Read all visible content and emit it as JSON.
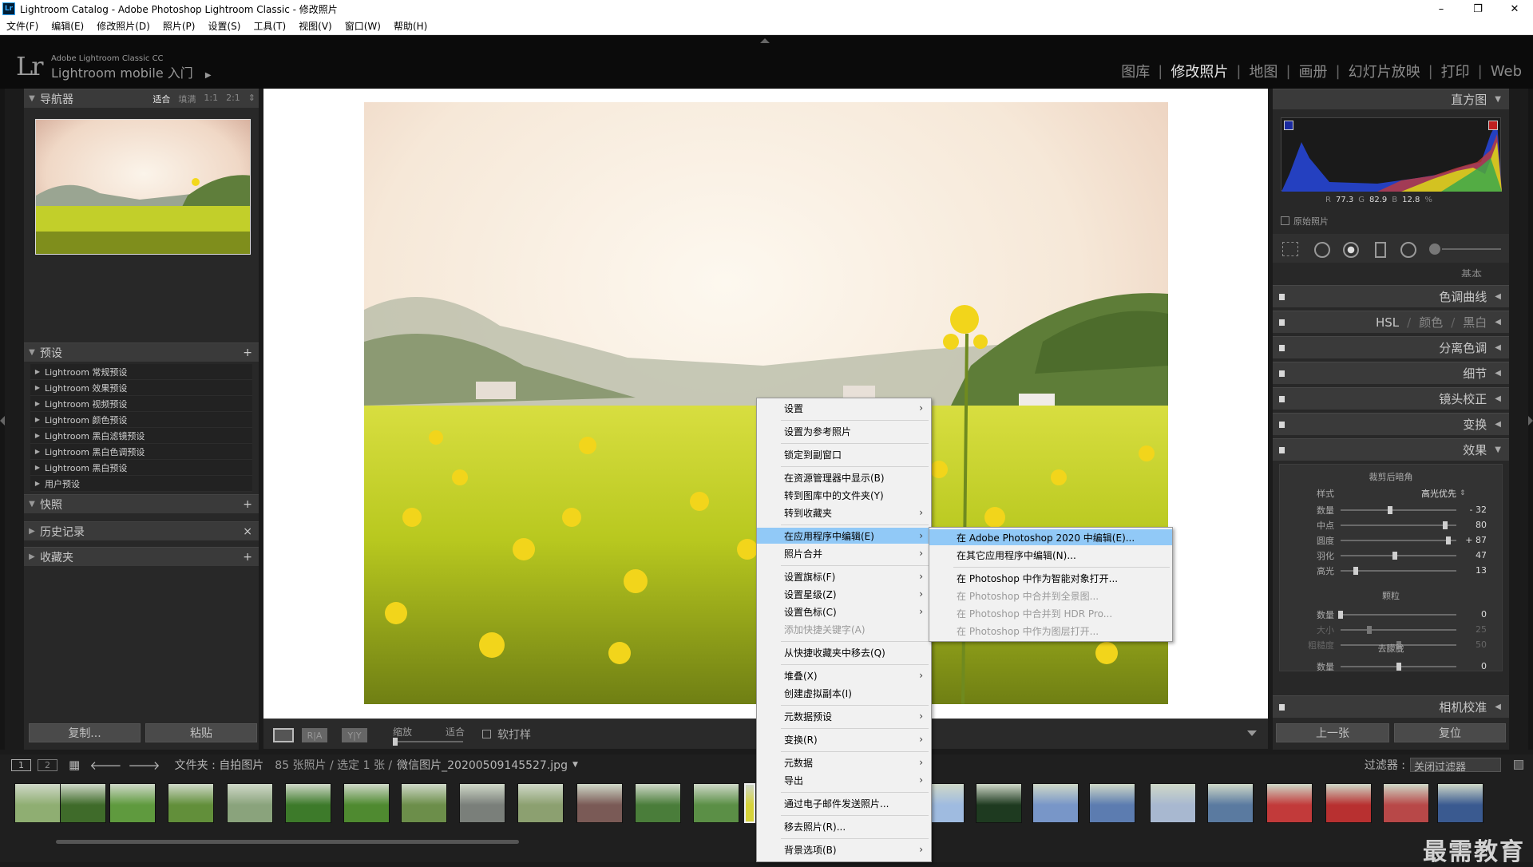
{
  "window": {
    "title": "Lightroom Catalog - Adobe Photoshop Lightroom Classic - 修改照片",
    "badge": "Lr",
    "min": "–",
    "restore": "❐",
    "close": "✕"
  },
  "menubar": [
    "文件(F)",
    "编辑(E)",
    "修改照片(D)",
    "照片(P)",
    "设置(S)",
    "工具(T)",
    "视图(V)",
    "窗口(W)",
    "帮助(H)"
  ],
  "identity": {
    "logo": "Lr",
    "sub": "Adobe Lightroom Classic CC",
    "main": "Lightroom mobile 入门",
    "arrow": "▶"
  },
  "modules": [
    "图库",
    "修改照片",
    "地图",
    "画册",
    "幻灯片放映",
    "打印",
    "Web"
  ],
  "module_sep": "|",
  "left": {
    "navigator": {
      "title": "导航器",
      "options": [
        "适合",
        "填满",
        "1:1",
        "2:1"
      ],
      "stepper": "⇕"
    },
    "presets": {
      "title": "预设",
      "plus": "+",
      "items": [
        "Lightroom 常规预设",
        "Lightroom 效果预设",
        "Lightroom 视频预设",
        "Lightroom 颜色预设",
        "Lightroom 黑白滤镜预设",
        "Lightroom 黑白色调预设",
        "Lightroom 黑白预设",
        "用户预设"
      ]
    },
    "snapshots": {
      "title": "快照",
      "plus": "+"
    },
    "history": {
      "title": "历史记录",
      "close": "×"
    },
    "collections": {
      "title": "收藏夹",
      "plus": "+"
    },
    "copy": "复制...",
    "paste": "粘贴"
  },
  "toolbar": {
    "zoom_label": "缩放",
    "zoom_value": "适合",
    "softproof": "软打样",
    "ry1": "R|A",
    "ry2": "Y|Y"
  },
  "right": {
    "histogram": {
      "title": "直方图",
      "r_label": "R",
      "r": "77.3",
      "g_label": "G",
      "g": "82.9",
      "b_label": "B",
      "b": "12.8",
      "pct": "%",
      "original": "原始照片"
    },
    "sections": [
      "基本",
      "色调曲线",
      "HSL",
      "颜色",
      "黑白",
      "分离色调",
      "细节",
      "镜头校正",
      "变换",
      "效果"
    ],
    "hsl_sep": "/",
    "vignette": {
      "title": "裁剪后暗角",
      "style_label": "样式",
      "style_value": "高光优先",
      "rows": [
        {
          "label": "数量",
          "value": "- 32",
          "pos": 0.43
        },
        {
          "label": "中点",
          "value": "80",
          "pos": 0.9
        },
        {
          "label": "圆度",
          "value": "+ 87",
          "pos": 0.93
        },
        {
          "label": "羽化",
          "value": "47",
          "pos": 0.47
        },
        {
          "label": "高光",
          "value": "13",
          "pos": 0.13
        }
      ]
    },
    "grain": {
      "title": "颗粒",
      "rows": [
        {
          "label": "数量",
          "value": "0",
          "pos": 0.0,
          "dim": false
        },
        {
          "label": "大小",
          "value": "25",
          "pos": 0.25,
          "dim": true
        },
        {
          "label": "粗糙度",
          "value": "50",
          "pos": 0.5,
          "dim": true
        }
      ]
    },
    "dehaze": {
      "title": "去朦胧",
      "rows": [
        {
          "label": "数量",
          "value": "0",
          "pos": 0.5
        }
      ]
    },
    "calibration": "相机校准",
    "prev": "上一张",
    "reset": "复位"
  },
  "filmbar": {
    "page1": "1",
    "page2": "2",
    "info": "文件夹 : 自拍图片",
    "count": "85 张照片 / 选定 1 张 /",
    "file": "微信图片_20200509145527.jpg",
    "filter_label": "过滤器 :",
    "filter_value": "关闭过滤器"
  },
  "context_menu": [
    {
      "label": "设置",
      "arrow": true
    },
    {
      "sep": true
    },
    {
      "label": "设置为参考照片"
    },
    {
      "sep": true
    },
    {
      "label": "锁定到副窗口"
    },
    {
      "sep": true
    },
    {
      "label": "在资源管理器中显示(B)"
    },
    {
      "label": "转到图库中的文件夹(Y)"
    },
    {
      "label": "转到收藏夹",
      "arrow": true
    },
    {
      "sep": true
    },
    {
      "label": "在应用程序中编辑(E)",
      "arrow": true,
      "highlight": true
    },
    {
      "label": "照片合并",
      "arrow": true
    },
    {
      "sep": true
    },
    {
      "label": "设置旗标(F)",
      "arrow": true
    },
    {
      "label": "设置星级(Z)",
      "arrow": true
    },
    {
      "label": "设置色标(C)",
      "arrow": true
    },
    {
      "label": "添加快捷关键字(A)",
      "disabled": true
    },
    {
      "sep": true
    },
    {
      "label": "从快捷收藏夹中移去(Q)"
    },
    {
      "sep": true
    },
    {
      "label": "堆叠(X)",
      "arrow": true
    },
    {
      "label": "创建虚拟副本(I)"
    },
    {
      "sep": true
    },
    {
      "label": "元数据预设",
      "arrow": true
    },
    {
      "sep": true
    },
    {
      "label": "变换(R)",
      "arrow": true
    },
    {
      "sep": true
    },
    {
      "label": "元数据",
      "arrow": true
    },
    {
      "label": "导出",
      "arrow": true
    },
    {
      "sep": true
    },
    {
      "label": "通过电子邮件发送照片..."
    },
    {
      "sep": true
    },
    {
      "label": "移去照片(R)..."
    },
    {
      "sep": true
    },
    {
      "label": "背景选项(B)",
      "arrow": true
    }
  ],
  "submenu": [
    {
      "label": "在 Adobe Photoshop 2020 中编辑(E)...",
      "highlight": true
    },
    {
      "label": "在其它应用程序中编辑(N)..."
    },
    {
      "sep": true
    },
    {
      "label": "在 Photoshop 中作为智能对象打开..."
    },
    {
      "label": "在 Photoshop 中合并到全景图...",
      "disabled": true
    },
    {
      "label": "在 Photoshop 中合并到 HDR Pro...",
      "disabled": true
    },
    {
      "label": "在 Photoshop 中作为图层打开...",
      "disabled": true
    }
  ],
  "watermark": "最需教育",
  "colors": {
    "accent": "#91c9f7",
    "panel": "#282828",
    "header": "#3a3a3a"
  }
}
